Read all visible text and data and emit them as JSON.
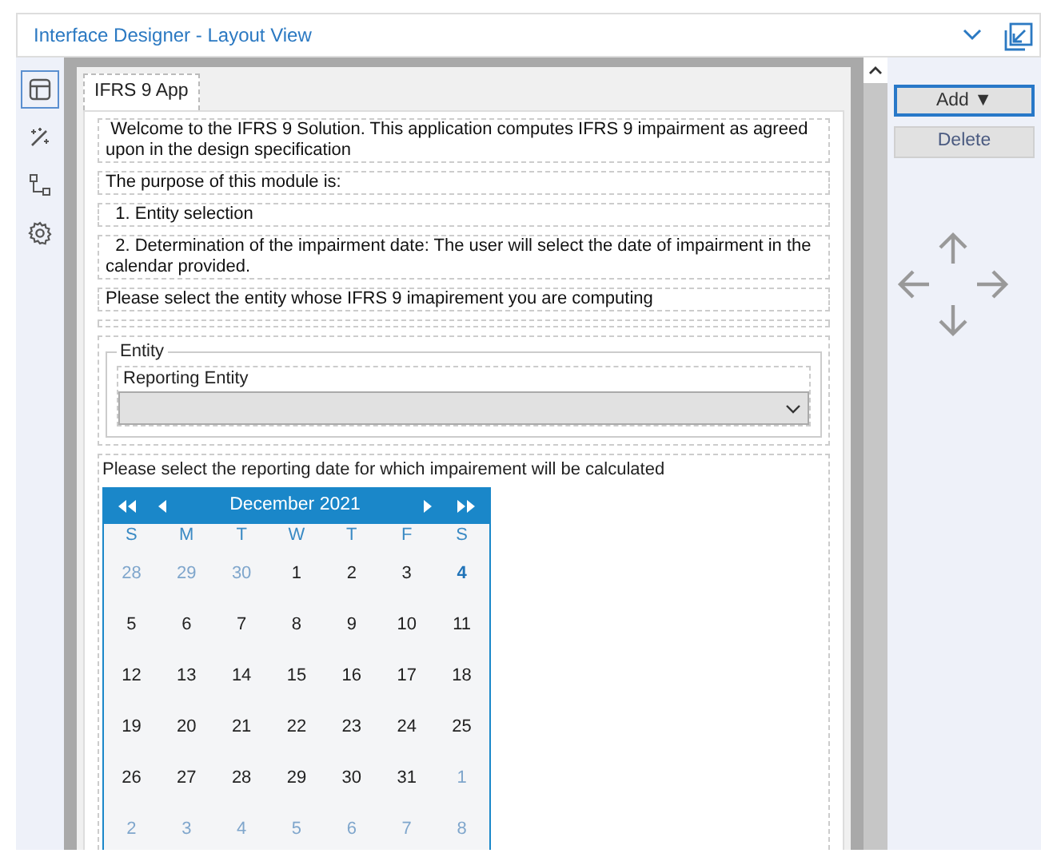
{
  "header": {
    "title": "Interface Designer - Layout View"
  },
  "sidebar": {
    "items": [
      {
        "selected": true
      },
      {
        "selected": false
      },
      {
        "selected": false
      },
      {
        "selected": false
      }
    ]
  },
  "tab": {
    "label": "IFRS 9 App"
  },
  "texts": [
    {
      "kind": "para",
      "text": " Welcome to the IFRS 9 Solution. This application computes IFRS 9 impairment as agreed upon in the design specification"
    },
    {
      "kind": "para",
      "text": "The purpose of this module is:"
    },
    {
      "kind": "para",
      "text": "  1. Entity selection"
    },
    {
      "kind": "para",
      "text": "  2. Determination of the impairment date: The user will select the date of impairment in the calendar provided."
    },
    {
      "kind": "para",
      "text": "Please select the entity whose IFRS 9 imapirement you are computing"
    },
    {
      "kind": "blank"
    }
  ],
  "entity_group": {
    "legend": "Entity",
    "dropdown_label": "Reporting Entity",
    "dropdown_disabled": true
  },
  "date_prompt": "Please select the reporting date for which impairement will be calculated",
  "calendar": {
    "month": "December 2021",
    "weekdays": [
      "S",
      "M",
      "T",
      "W",
      "T",
      "F",
      "S"
    ],
    "weeks": [
      [
        {
          "d": "28",
          "other": true,
          "today": false
        },
        {
          "d": "29",
          "other": true,
          "today": false
        },
        {
          "d": "30",
          "other": true,
          "today": false
        },
        {
          "d": "1",
          "other": false,
          "today": false
        },
        {
          "d": "2",
          "other": false,
          "today": false
        },
        {
          "d": "3",
          "other": false,
          "today": false
        },
        {
          "d": "4",
          "other": false,
          "today": true
        }
      ],
      [
        {
          "d": "5",
          "other": false,
          "today": false
        },
        {
          "d": "6",
          "other": false,
          "today": false
        },
        {
          "d": "7",
          "other": false,
          "today": false
        },
        {
          "d": "8",
          "other": false,
          "today": false
        },
        {
          "d": "9",
          "other": false,
          "today": false
        },
        {
          "d": "10",
          "other": false,
          "today": false
        },
        {
          "d": "11",
          "other": false,
          "today": false
        }
      ],
      [
        {
          "d": "12",
          "other": false,
          "today": false
        },
        {
          "d": "13",
          "other": false,
          "today": false
        },
        {
          "d": "14",
          "other": false,
          "today": false
        },
        {
          "d": "15",
          "other": false,
          "today": false
        },
        {
          "d": "16",
          "other": false,
          "today": false
        },
        {
          "d": "17",
          "other": false,
          "today": false
        },
        {
          "d": "18",
          "other": false,
          "today": false
        }
      ],
      [
        {
          "d": "19",
          "other": false,
          "today": false
        },
        {
          "d": "20",
          "other": false,
          "today": false
        },
        {
          "d": "21",
          "other": false,
          "today": false
        },
        {
          "d": "22",
          "other": false,
          "today": false
        },
        {
          "d": "23",
          "other": false,
          "today": false
        },
        {
          "d": "24",
          "other": false,
          "today": false
        },
        {
          "d": "25",
          "other": false,
          "today": false
        }
      ],
      [
        {
          "d": "26",
          "other": false,
          "today": false
        },
        {
          "d": "27",
          "other": false,
          "today": false
        },
        {
          "d": "28",
          "other": false,
          "today": false
        },
        {
          "d": "29",
          "other": false,
          "today": false
        },
        {
          "d": "30",
          "other": false,
          "today": false
        },
        {
          "d": "31",
          "other": false,
          "today": false
        },
        {
          "d": "1",
          "other": true,
          "today": false
        }
      ],
      [
        {
          "d": "2",
          "other": true,
          "today": false
        },
        {
          "d": "3",
          "other": true,
          "today": false
        },
        {
          "d": "4",
          "other": true,
          "today": false
        },
        {
          "d": "5",
          "other": true,
          "today": false
        },
        {
          "d": "6",
          "other": true,
          "today": false
        },
        {
          "d": "7",
          "other": true,
          "today": false
        },
        {
          "d": "8",
          "other": true,
          "today": false
        }
      ]
    ]
  },
  "buttons": [
    {
      "label": "Add ▼",
      "focused": true
    },
    {
      "label": "Delete",
      "focused": false
    }
  ]
}
